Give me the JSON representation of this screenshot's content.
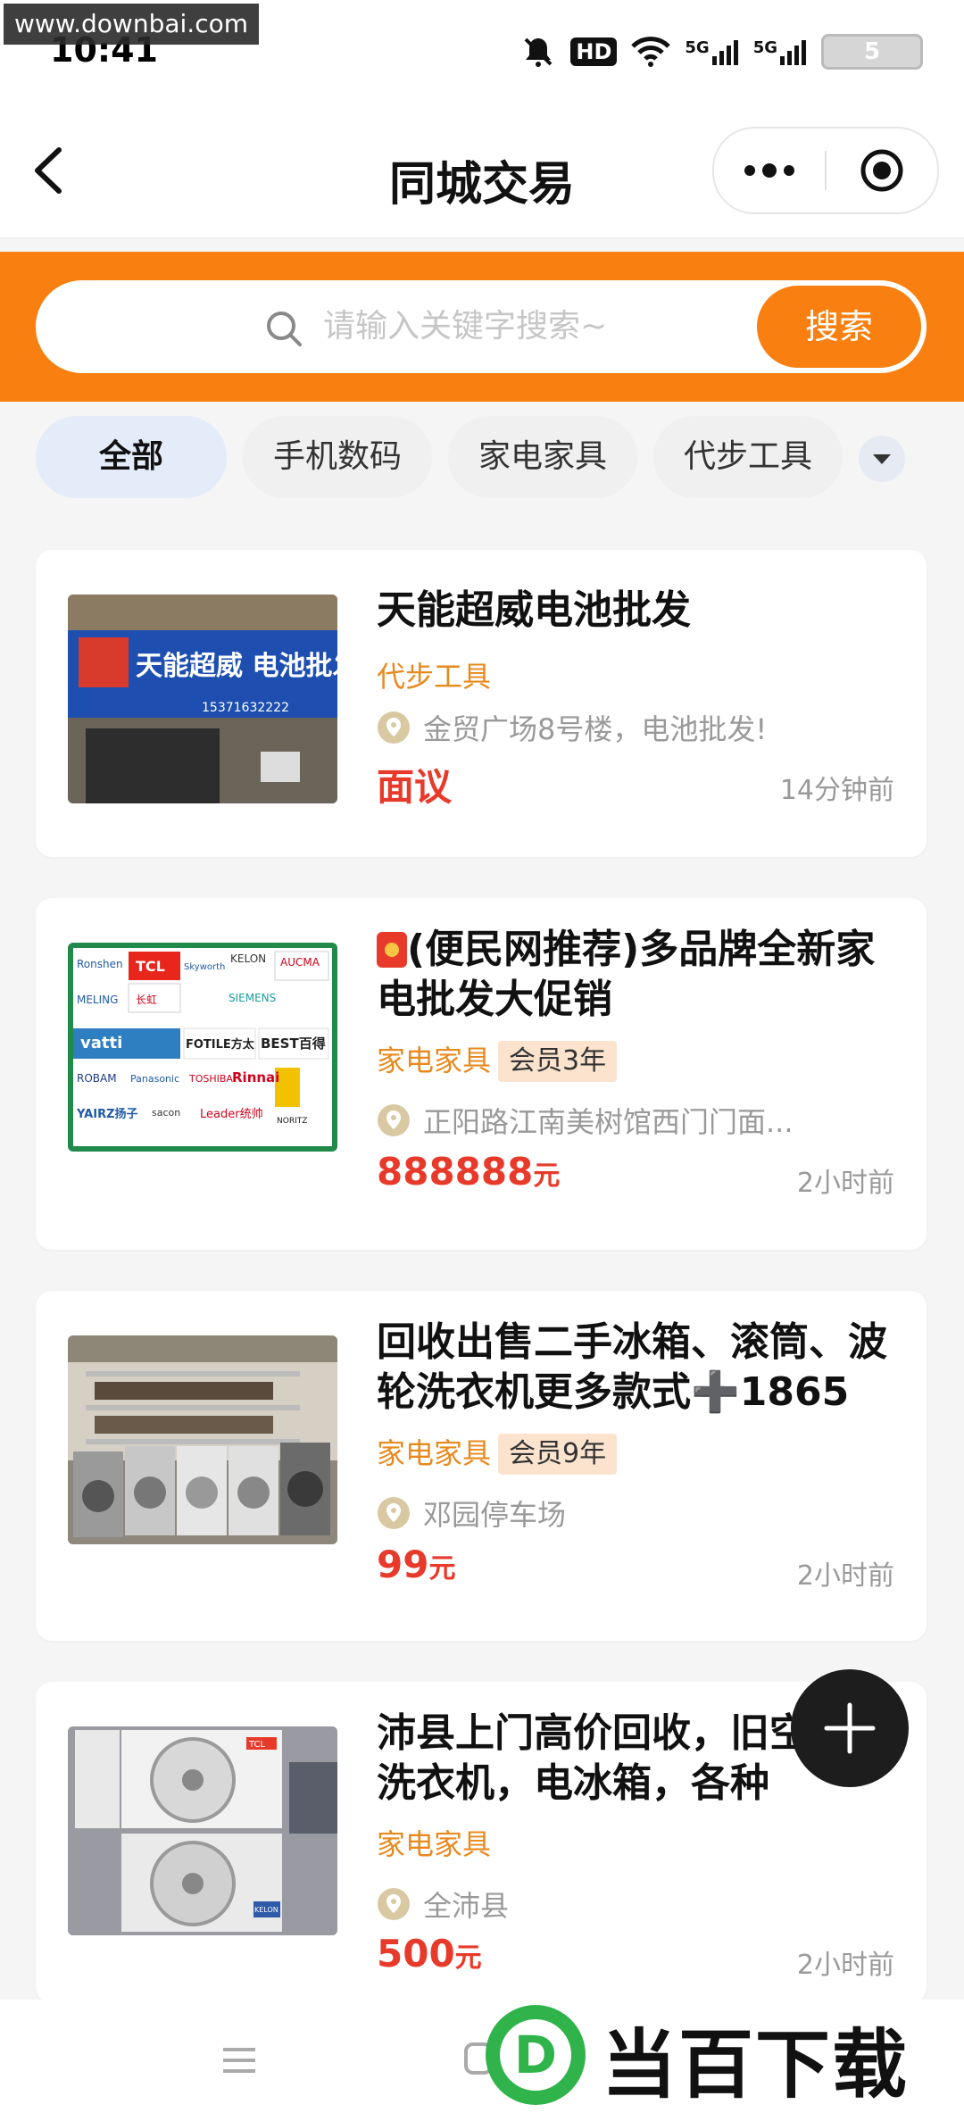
{
  "status": {
    "watermark": "www.downbai.com",
    "time": "10:41",
    "net1": "HD",
    "sim1": "5G",
    "sim2": "5G",
    "battery": "5"
  },
  "titlebar": {
    "title": "同城交易"
  },
  "search": {
    "placeholder": "请输入关键字搜索~",
    "button": "搜索"
  },
  "tabs": [
    "全部",
    "手机数码",
    "家电家具",
    "代步工具"
  ],
  "listings": [
    {
      "title": "天能超威电池批发",
      "category": "代步工具",
      "location": "金贸广场8号楼，电池批发!",
      "price": "面议",
      "price_unit": "",
      "time": "14分钟前",
      "image_sign": "天能超威 电池批发",
      "image_phone": "15371632222"
    },
    {
      "title": "(便民网推荐)多品牌全新家电批发大促销",
      "category": "家电家具",
      "member": "会员3年",
      "location": "正阳路江南美树馆西门门面...",
      "price": "888888",
      "price_unit": "元",
      "time": "2小时前",
      "image_brands": [
        "Ronshen",
        "TCL",
        "Skyworth",
        "KELON",
        "AUCMA",
        "MELING",
        "长虹",
        "SIEMENS",
        "vatti",
        "FOTILE方太",
        "BEST百得",
        "ROBAM",
        "Panasonic",
        "TOSHIBA",
        "Rinnai",
        "YAIRZ扬子",
        "sacon",
        "Leader统帅",
        "NORITZ"
      ]
    },
    {
      "title": "回收出售二手冰箱、滚筒、波轮洗衣机更多款式➕1865",
      "category": "家电家具",
      "member": "会员9年",
      "location": "邓园停车场",
      "price": "99",
      "price_unit": "元",
      "time": "2小时前"
    },
    {
      "title": "沛县上门高价回收，旧空调，洗衣机，电冰箱，各种",
      "category": "家电家具",
      "location": "全沛县",
      "price": "500",
      "price_unit": "元",
      "time": "2小时前",
      "image_brands": [
        "TCL",
        "KELON"
      ]
    }
  ],
  "footer": {
    "brand": "当百下载",
    "brand_letter": "D"
  },
  "colors": {
    "accent": "#f98010",
    "price": "#e83a2a",
    "category": "#e8891e",
    "member_bg": "#fbe3ce"
  }
}
